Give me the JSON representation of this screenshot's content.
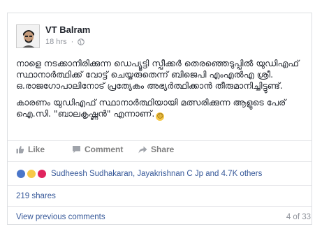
{
  "post": {
    "author": "VT Balram",
    "timestamp": "18 hrs",
    "privacy_icon": "globe-icon",
    "paragraphs": [
      "നാളെ നടക്കാനിരിക്കുന്ന ഡെപ്യൂട്ടി സ്പീക്കർ തെരഞ്ഞെടുപ്പിൽ യുഡിഎഫ് സ്ഥാനാർത്ഥിക്ക് വോട്ട് ചെയ്യരുതെന്ന് ബിജെപി എംഎൽഎ ശ്രീ. ഒ.രാജഗോപാലിനോട് പ്രത്യേകം അഭ്യർത്ഥിക്കാൻ തീരുമാനിച്ചിട്ടുണ്ട്.",
      "കാരണം യുഡിഎഫ് സ്ഥാനാർത്ഥിയായി മത്സരിക്കുന്ന ആളുടെ പേര് ഐ.സി. \"ബാലകൃഷ്ണൻ\" എന്നാണ്."
    ],
    "emoji": "😌"
  },
  "actions": {
    "like": "Like",
    "comment": "Comment",
    "share": "Share"
  },
  "reactions": {
    "icons": [
      "like-reaction-icon",
      "haha-reaction-icon",
      "love-reaction-icon"
    ],
    "text": "Sudheesh Sudhakaran, Jayakrishnan C Jp and 4.7K others"
  },
  "shares": "219 shares",
  "comments": {
    "view_previous": "View previous comments",
    "count": "4 of 33"
  },
  "colors": {
    "link": "#365899",
    "meta": "#90949c",
    "border": "#dddfe2"
  }
}
